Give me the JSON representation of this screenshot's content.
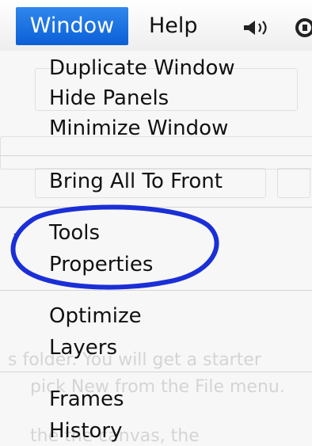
{
  "menubar": {
    "active_menu": "Window",
    "help_menu": "Help",
    "icons": [
      "speaker-icon",
      "status-icon"
    ],
    "accent_color": "#1a6fe3"
  },
  "window_menu": {
    "groups": [
      [
        {
          "label": "Duplicate Window"
        },
        {
          "label": "Hide Panels"
        },
        {
          "label": "Minimize Window"
        }
      ],
      [
        {
          "label": "Bring All To Front"
        }
      ],
      [
        {
          "label": "Tools",
          "checked": true
        },
        {
          "label": "Properties"
        }
      ],
      [
        {
          "label": "Optimize"
        },
        {
          "label": "Layers"
        }
      ],
      [
        {
          "label": "Frames"
        },
        {
          "label": "History"
        }
      ]
    ],
    "annotation": {
      "color": "#1a2fd6",
      "circled_items": [
        "Tools",
        "Properties"
      ]
    }
  },
  "background_text": {
    "line1": "s folder.  You will get a starter",
    "line2": "pick New from the File menu.",
    "line3": "the        the canvas, the"
  }
}
